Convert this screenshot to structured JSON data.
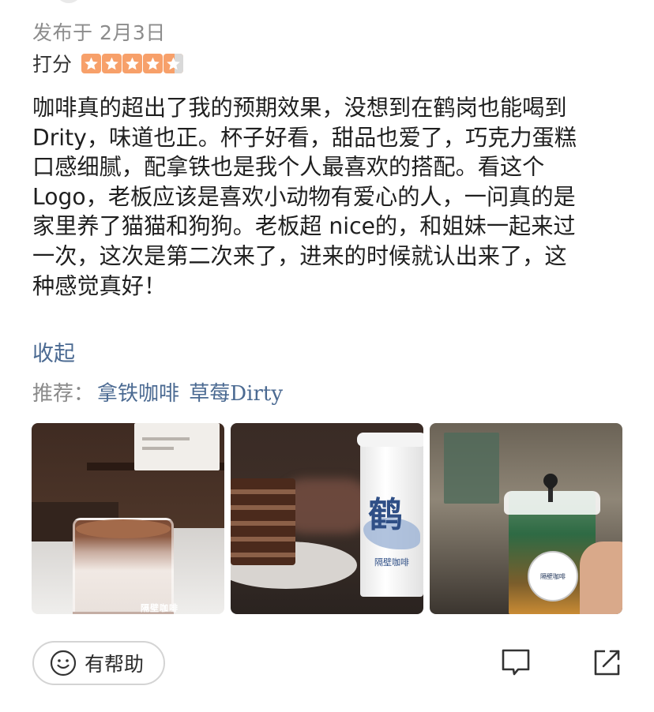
{
  "review": {
    "date": "发布于 2月3日",
    "rating_label": "打分",
    "rating": 4.5,
    "rating_max": 5,
    "body_lines": [
      "咖啡真的超出了我的预期效果，没想到在鹤岗也能喝到",
      "Drity，味道也正。杯子好看，甜品也爱了，巧克力蛋糕",
      "口感细腻，配拿铁也是我个人最喜欢的搭配。看这个",
      "Logo，老板应该是喜欢小动物有爱心的人，一问真的是",
      "家里养了猫猫和狗狗。老板超 nice的，和姐妹一起来过",
      "一次，这次是第二次来了，进来的时候就认出来了，这",
      "种感觉真好！"
    ],
    "collapse_label": "收起",
    "recommend_label": "推荐：",
    "recommended_dishes": [
      "拿铁咖啡",
      "草莓Dirty"
    ]
  },
  "photos": [
    {
      "semantic": "dirty-coffee-photo",
      "caption": "隔壁咖啡"
    },
    {
      "semantic": "cake-and-cup-photo",
      "cup_mark": "鹤",
      "cup_sub": "隔壁咖啡"
    },
    {
      "semantic": "layered-drink-photo",
      "sticker": "隔壁咖啡"
    }
  ],
  "actions": {
    "helpful_label": "有帮助",
    "comment_icon": "comment-icon",
    "share_icon": "share-icon"
  },
  "colors": {
    "star": "#f7a06a",
    "link": "#4b6a92",
    "meta": "#8c8c8c"
  }
}
